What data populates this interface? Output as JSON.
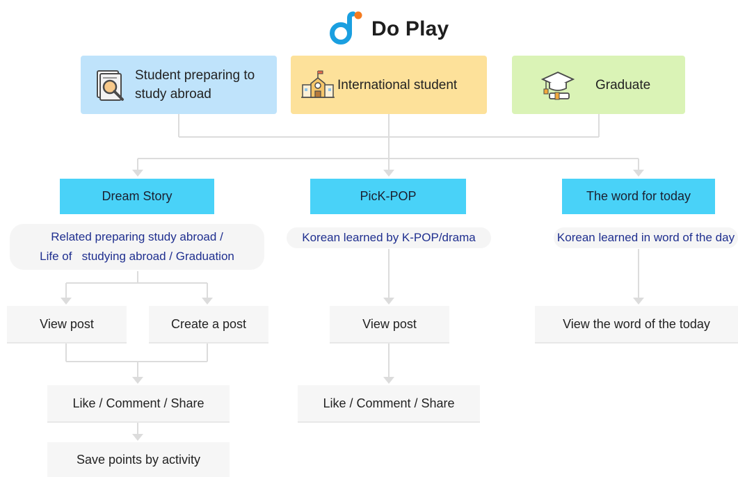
{
  "brand": {
    "name": "Do Play",
    "accent": "#1a9fe0",
    "dot_color": "#f47b20"
  },
  "user_types": {
    "preparing": {
      "label": "Student preparing to\nstudy abroad",
      "icon": "magnifier-document-icon",
      "color": "#bfe3fb"
    },
    "international": {
      "label": "International student",
      "icon": "school-building-icon",
      "color": "#fde19a"
    },
    "graduate": {
      "label": "Graduate",
      "icon": "graduation-cap-diploma-icon",
      "color": "#daf3b6"
    }
  },
  "categories": {
    "dream_story": {
      "label": "Dream Story",
      "color": "#49d2f8"
    },
    "pick_pop": {
      "label": "PicK-POP",
      "color": "#49d2f8"
    },
    "word_today": {
      "label": "The word for today",
      "color": "#49d2f8"
    }
  },
  "descriptions": {
    "dream_story": {
      "line1": "Related preparing study abroad /",
      "line2": "Life of   studying abroad / Graduation"
    },
    "pick_pop": "Korean learned by K-POP/drama",
    "word_today": "Korean learned in word of the day"
  },
  "actions": {
    "dream_view": "View post",
    "dream_create": "Create a post",
    "dream_like": "Like / Comment / Share",
    "dream_save": "Save points by activity",
    "pickpop_view": "View post",
    "pickpop_like": "Like / Comment / Share",
    "word_view": "View the word of the today"
  },
  "connector_color": "#dcdcdc"
}
